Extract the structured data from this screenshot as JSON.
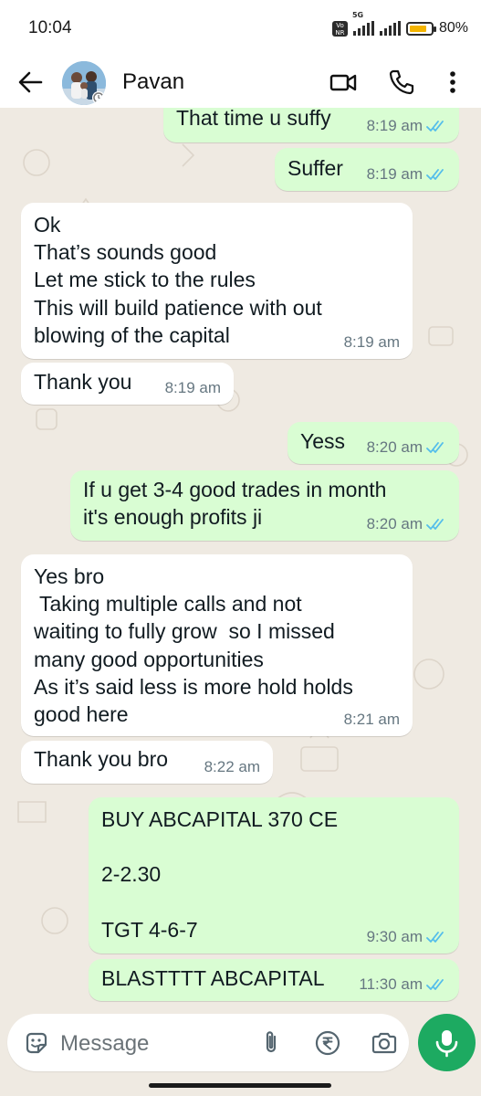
{
  "status_bar": {
    "time": "10:04",
    "volte_label": "Vo\nNR",
    "network_label": "5G",
    "battery_percent_text": "80%",
    "battery_level": 0.8
  },
  "header": {
    "contact_name": "Pavan"
  },
  "messages": [
    {
      "direction": "out",
      "text": "That time u suffy",
      "time": "8:19 am",
      "ticks": "read"
    },
    {
      "direction": "out",
      "text": "Suffer",
      "time": "8:19 am",
      "ticks": "read"
    },
    {
      "direction": "in",
      "text": "Ok\nThat’s sounds good\nLet me stick to the rules\nThis will build patience with out\nblowing of the capital",
      "time": "8:19 am"
    },
    {
      "direction": "in",
      "text": "Thank you",
      "time": "8:19 am"
    },
    {
      "direction": "out",
      "text": "Yess",
      "time": "8:20 am",
      "ticks": "read"
    },
    {
      "direction": "out",
      "text": "If u get 3-4 good trades in month\nit's enough profits ji",
      "time": "8:20 am",
      "ticks": "read"
    },
    {
      "direction": "in",
      "text": "Yes bro\n Taking multiple calls and not\nwaiting to fully grow  so I missed\nmany good opportunities\nAs it’s said less is more hold holds\ngood here",
      "time": "8:21 am"
    },
    {
      "direction": "in",
      "text": "Thank you bro",
      "time": "8:22 am"
    },
    {
      "direction": "out",
      "text": "BUY ABCAPITAL 370 CE\n\n2-2.30\n\nTGT 4-6-7",
      "time": "9:30 am",
      "ticks": "read"
    },
    {
      "direction": "out",
      "text": "BLASTTTT ABCAPITAL",
      "time": "11:30 am",
      "ticks": "read"
    }
  ],
  "composer": {
    "placeholder": "Message"
  },
  "colors": {
    "outgoing_bubble": "#d9fdd3",
    "incoming_bubble": "#ffffff",
    "chat_background": "#efeae2",
    "read_ticks": "#53bdeb",
    "mic_button": "#1daa61"
  },
  "icons": [
    "back-arrow-icon",
    "video-call-icon",
    "voice-call-icon",
    "more-options-icon",
    "sticker-icon",
    "attach-icon",
    "rupee-payment-icon",
    "camera-icon",
    "mic-icon",
    "read-receipt-icon"
  ]
}
